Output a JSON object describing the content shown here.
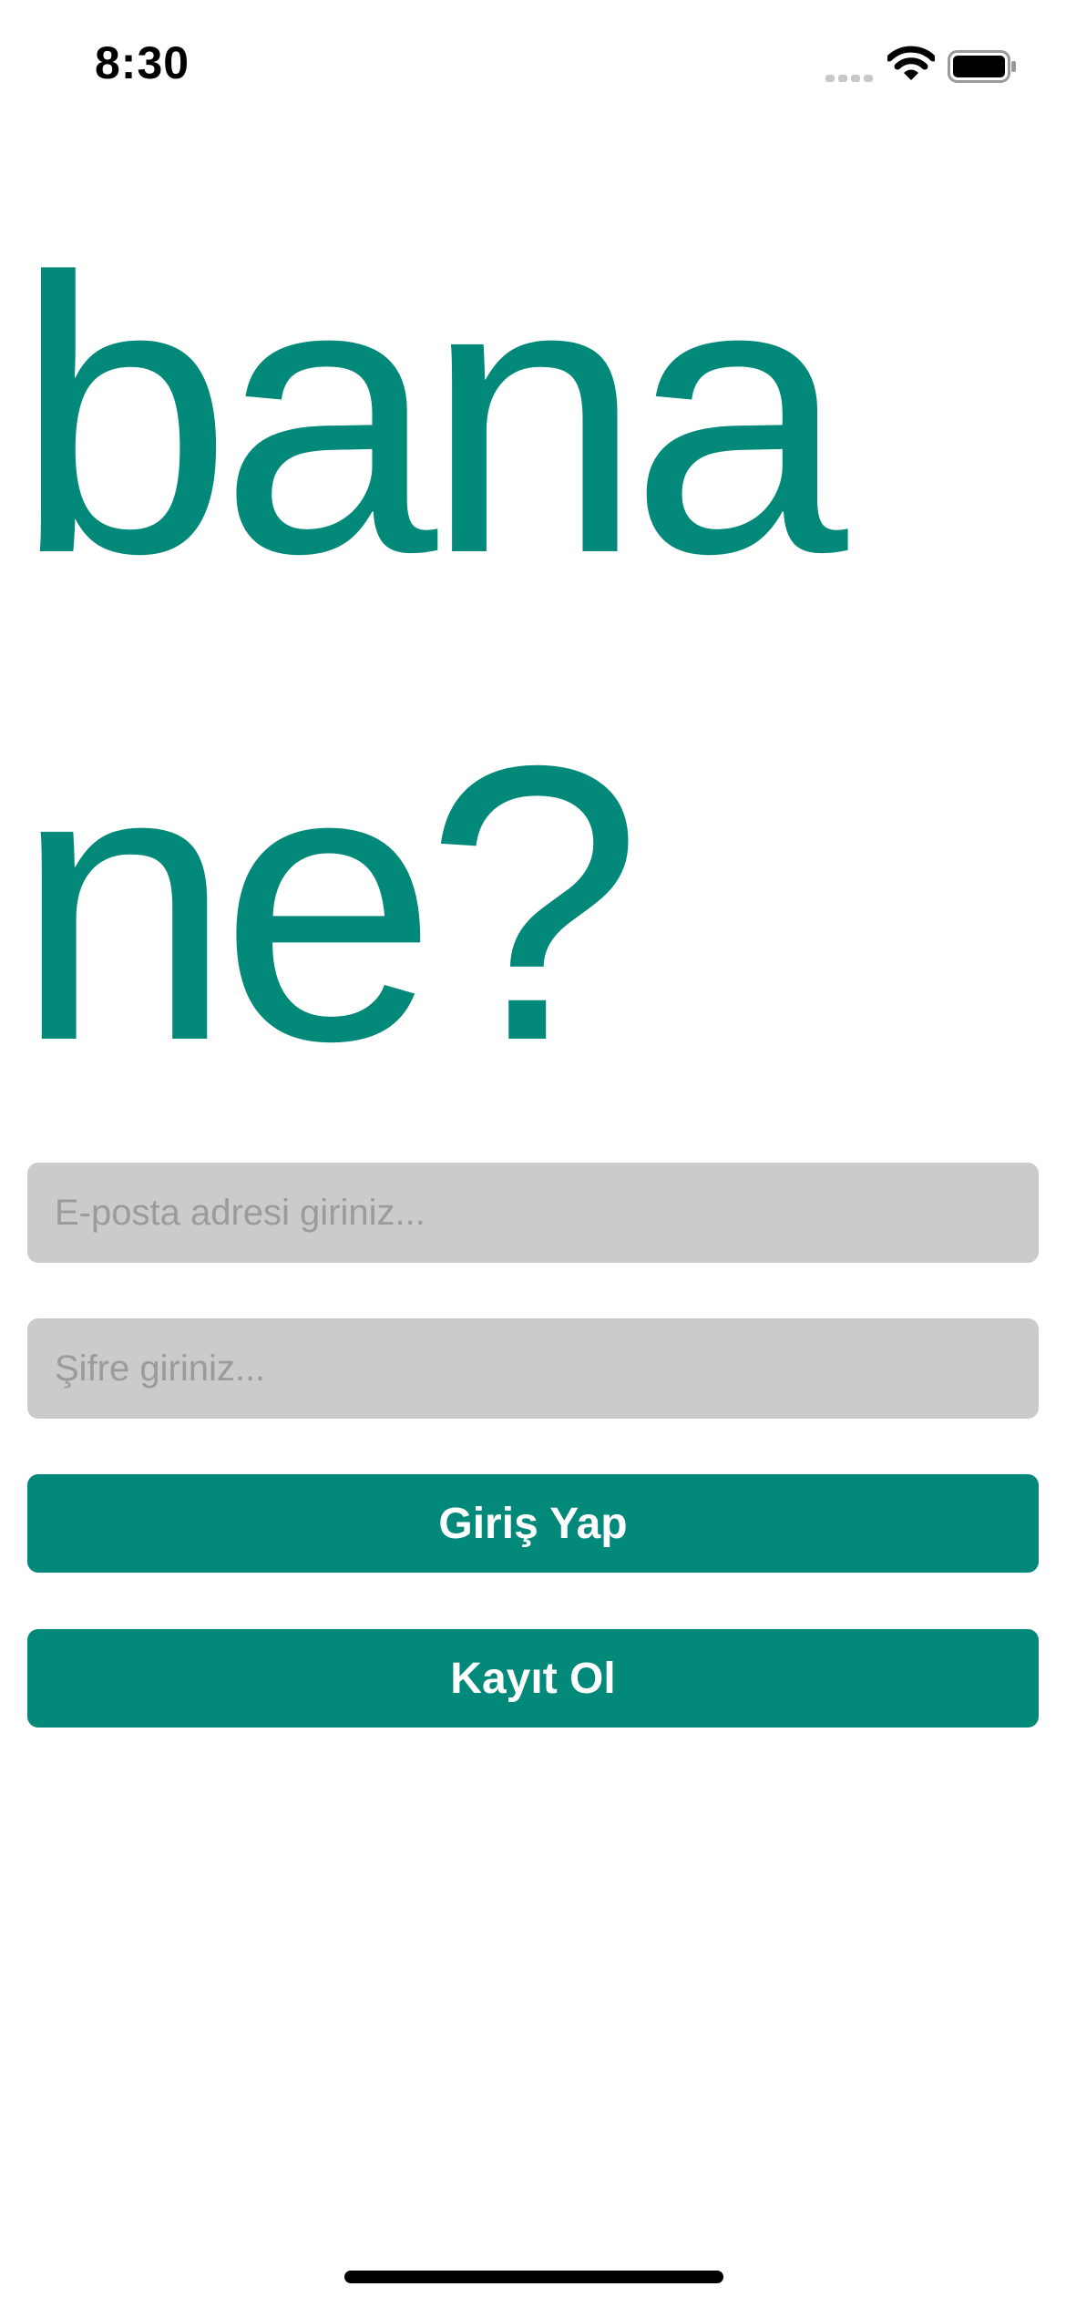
{
  "status_bar": {
    "time": "8:30",
    "icons": [
      "signal-icon",
      "wifi-icon",
      "battery-icon"
    ]
  },
  "hero": {
    "title": "bana\nne?"
  },
  "login_form": {
    "email_placeholder": "E-posta adresi giriniz...",
    "email_value": "",
    "password_placeholder": "Şifre giriniz...",
    "password_value": "",
    "login_label": "Giriş Yap",
    "register_label": "Kayıt Ol"
  },
  "colors": {
    "accent": "#02897a",
    "input_background": "#cbcbcb",
    "placeholder": "#9b9b9b",
    "button_text": "#ffffff"
  }
}
